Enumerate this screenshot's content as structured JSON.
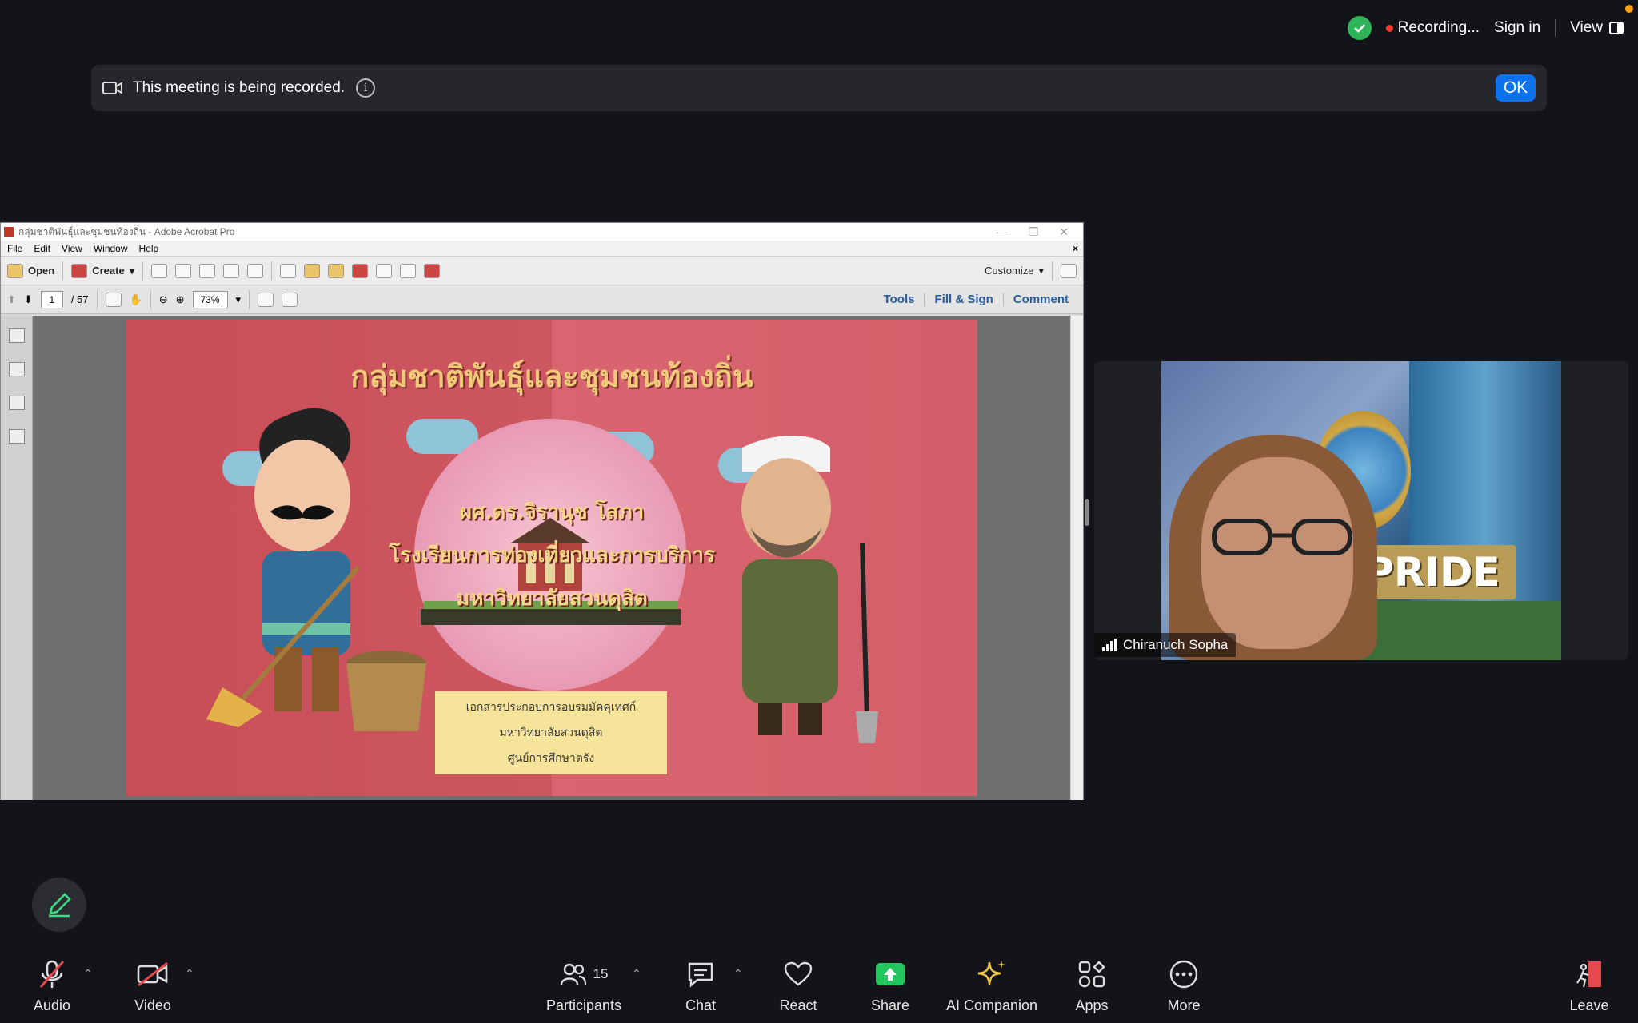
{
  "status": {
    "recording_label": "Recording...",
    "sign_in": "Sign in",
    "view": "View"
  },
  "banner": {
    "message": "This meeting is being recorded.",
    "info": "i",
    "ok": "OK"
  },
  "acrobat": {
    "title": "กลุ่มชาติพันธุ์และชุมชนท้องถิ่น - Adobe Acrobat Pro",
    "menu": [
      "File",
      "Edit",
      "View",
      "Window",
      "Help"
    ],
    "toolbar": {
      "open": "Open",
      "create": "Create",
      "customize": "Customize"
    },
    "nav": {
      "page": "1",
      "total": "/ 57",
      "zoom": "73%"
    },
    "panels": [
      "Tools",
      "Fill & Sign",
      "Comment"
    ]
  },
  "slide": {
    "title": "กลุ่มชาติพันธุ์และชุมชนท้องถิ่น",
    "author": "ผศ.ดร.จิรานุช โสภา",
    "school": "โรงเรียนการท่องเที่ยวและการบริการ",
    "university": "มหาวิทยาลัยสวนดุสิต",
    "note_lines": [
      "เอกสารประกอบการอบรมมัคคุเทศก์",
      "มหาวิทยาลัยสวนดุสิต",
      "ศูนย์การศึกษาตรัง"
    ]
  },
  "video": {
    "participant_name": "Chiranuch Sopha",
    "banner_text": "PRIDE"
  },
  "toolbar": {
    "audio": "Audio",
    "video": "Video",
    "participants": "Participants",
    "participant_count": "15",
    "chat": "Chat",
    "react": "React",
    "share": "Share",
    "ai_companion": "AI Companion",
    "apps": "Apps",
    "more": "More",
    "leave": "Leave"
  },
  "colors": {
    "share_green": "#23c55e",
    "leave_red": "#e5484d",
    "ok_blue": "#0e72ed"
  }
}
